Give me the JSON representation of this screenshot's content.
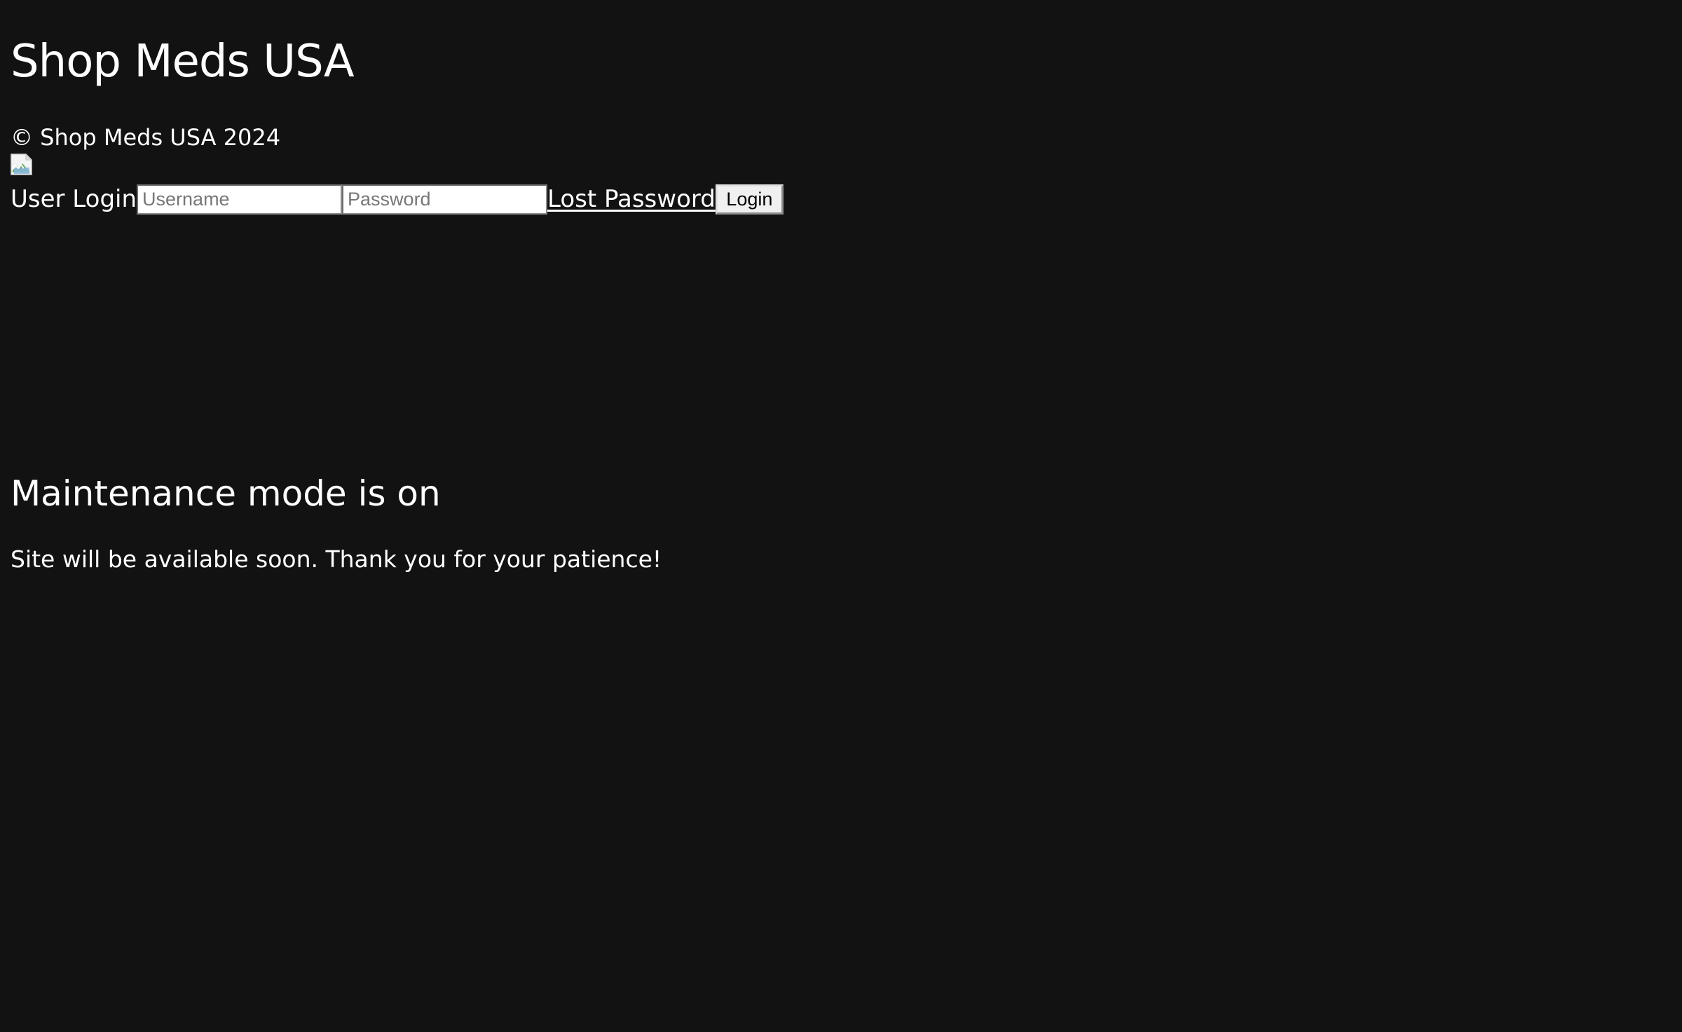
{
  "site": {
    "title": "Shop Meds USA",
    "copyright": "© Shop Meds USA 2024"
  },
  "login": {
    "label": "User Login",
    "username_placeholder": "Username",
    "username_value": "",
    "password_placeholder": "Password",
    "password_value": "",
    "lost_password_label": "Lost Password",
    "button_label": "Login"
  },
  "maintenance": {
    "heading": "Maintenance mode is on",
    "message": "Site will be available soon. Thank you for your patience!"
  },
  "colors": {
    "background": "#121212",
    "text": "#ffffff",
    "input_background": "#ffffff",
    "button_background": "#f0f0f0"
  },
  "icons": {
    "broken_image": "broken-image-icon"
  }
}
